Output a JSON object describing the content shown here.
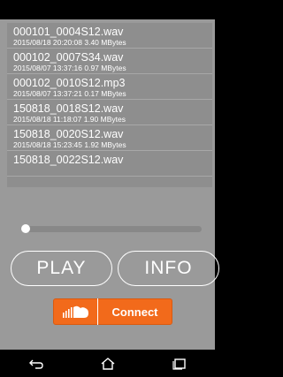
{
  "files": [
    {
      "name": "000101_0004S12.wav",
      "meta": "2015/08/18 20:20:08 3.40 MBytes"
    },
    {
      "name": "000102_0007S34.wav",
      "meta": "2015/08/07 13:37:16 0.97 MBytes"
    },
    {
      "name": "000102_0010S12.mp3",
      "meta": "2015/08/07 13:37:21 0.17 MBytes"
    },
    {
      "name": "150818_0018S12.wav",
      "meta": "2015/08/18 11:18:07 1.90 MBytes"
    },
    {
      "name": "150818_0020S12.wav",
      "meta": "2015/08/18 15:23:45 1.92 MBytes"
    },
    {
      "name": "150818_0022S12.wav",
      "meta": ""
    }
  ],
  "controls": {
    "play_label": "PLAY",
    "info_label": "INFO",
    "connect_label": "Connect",
    "seek_progress": 0.0
  },
  "colors": {
    "accent": "#f26a1b",
    "background": "#9a9a9a",
    "list_background": "#8e8e8e"
  },
  "icons": {
    "connect": "soundcloud-icon",
    "nav_back": "back-icon",
    "nav_home": "home-icon",
    "nav_recent": "recent-apps-icon"
  }
}
